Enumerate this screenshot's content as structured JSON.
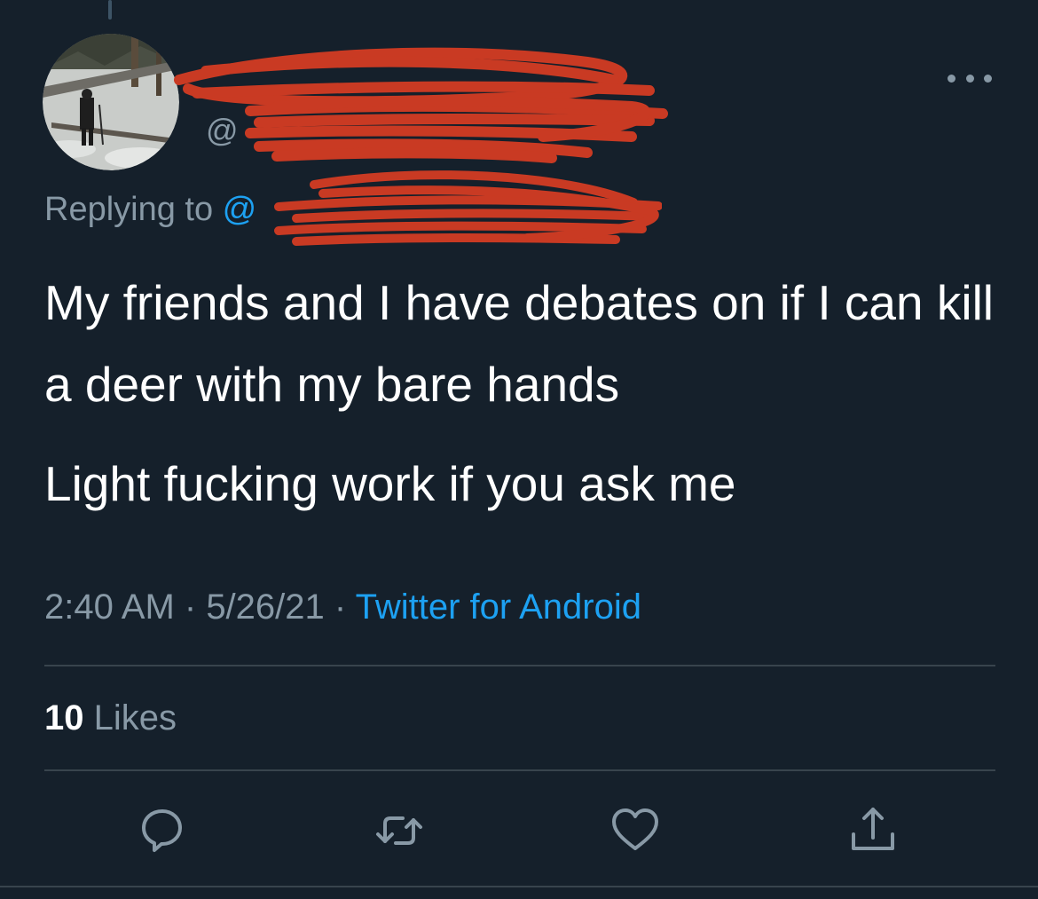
{
  "author": {
    "handle_prefix": "@"
  },
  "reply_context": {
    "prefix": "Replying to ",
    "handle": "@"
  },
  "tweet": {
    "paragraphs": [
      "My friends and I have debates on if I can kill a deer with my bare hands",
      "Light fucking work if you ask me"
    ]
  },
  "meta": {
    "time": "2:40 AM",
    "separator": " · ",
    "date": "5/26/21",
    "source": "Twitter for Android"
  },
  "stats": {
    "likes_count": "10",
    "likes_label": " Likes"
  },
  "icons": {
    "more": "more-icon",
    "reply": "reply-icon",
    "retweet": "retweet-icon",
    "like": "heart-icon",
    "share": "share-icon"
  },
  "colors": {
    "background": "#15202b",
    "text": "#ffffff",
    "secondary_text": "#8899a6",
    "link": "#1da1f2",
    "divider": "#38444d",
    "redaction": "#c93a23"
  }
}
